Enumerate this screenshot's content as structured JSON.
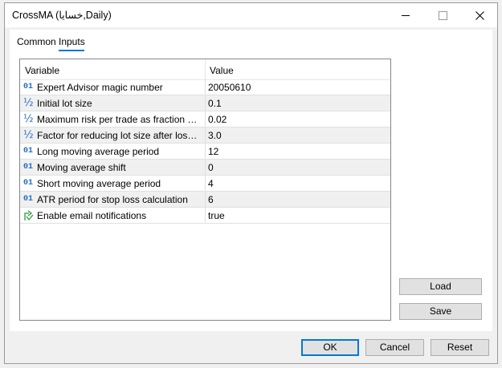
{
  "window": {
    "title": "CrossMA (خسايا,Daily)"
  },
  "tabs": [
    {
      "label": "Common"
    },
    {
      "label": "Inputs"
    }
  ],
  "grid": {
    "columns": [
      "Variable",
      "Value"
    ],
    "rows": [
      {
        "icon": "01",
        "icon_type": "integer-icon",
        "name": "Expert Advisor magic number",
        "value": "20050610"
      },
      {
        "icon": "½",
        "icon_type": "double-icon",
        "name": "Initial lot size",
        "value": "0.1"
      },
      {
        "icon": "½",
        "icon_type": "double-icon",
        "name": "Maximum risk per trade as fraction of free margin",
        "value": "0.02"
      },
      {
        "icon": "½",
        "icon_type": "double-icon",
        "name": "Factor for reducing lot size after losses",
        "value": "3.0"
      },
      {
        "icon": "01",
        "icon_type": "integer-icon",
        "name": "Long moving average period",
        "value": "12"
      },
      {
        "icon": "01",
        "icon_type": "integer-icon",
        "name": "Moving average shift",
        "value": "0"
      },
      {
        "icon": "01",
        "icon_type": "integer-icon",
        "name": "Short moving average period",
        "value": "4"
      },
      {
        "icon": "01",
        "icon_type": "integer-icon",
        "name": "ATR period for stop loss calculation",
        "value": "6"
      },
      {
        "icon": "",
        "icon_type": "boolean-icon",
        "name": "Enable email notifications",
        "value": "true"
      }
    ]
  },
  "buttons": {
    "load": "Load",
    "save": "Save",
    "ok": "OK",
    "cancel": "Cancel",
    "reset": "Reset"
  },
  "colors": {
    "accent": "#0078d7",
    "icon_blue": "#1e6fc2",
    "bool_green": "#2a9d3a"
  }
}
